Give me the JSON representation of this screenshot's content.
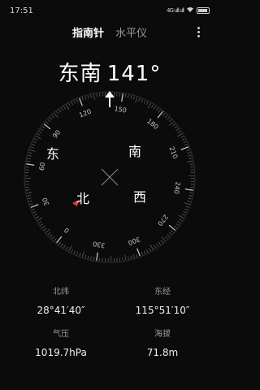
{
  "status_bar": {
    "time": "17:51",
    "signal": "4G ull ull",
    "wifi": "wifi-icon"
  },
  "tabs": [
    {
      "label": "指南针",
      "active": true
    },
    {
      "label": "水平仪",
      "active": false
    }
  ],
  "heading": {
    "direction": "东南",
    "degrees": "141°"
  },
  "compass": {
    "directions": {
      "east": "东",
      "south": "南",
      "west": "西",
      "north": "北"
    },
    "tick_labels": [
      "90",
      "120",
      "150",
      "180",
      "210",
      "240",
      "270",
      "300",
      "330",
      "0",
      "30",
      "60"
    ]
  },
  "info": {
    "latitude_label": "北纬",
    "latitude_value": "28°41′40″",
    "longitude_label": "东经",
    "longitude_value": "115°51′10″",
    "pressure_label": "气压",
    "pressure_value": "1019.7hPa",
    "altitude_label": "海拔",
    "altitude_value": "71.8m"
  },
  "colors": {
    "background": "#0b0b0b",
    "north_marker": "#e23b3b",
    "text": "#ffffff"
  }
}
